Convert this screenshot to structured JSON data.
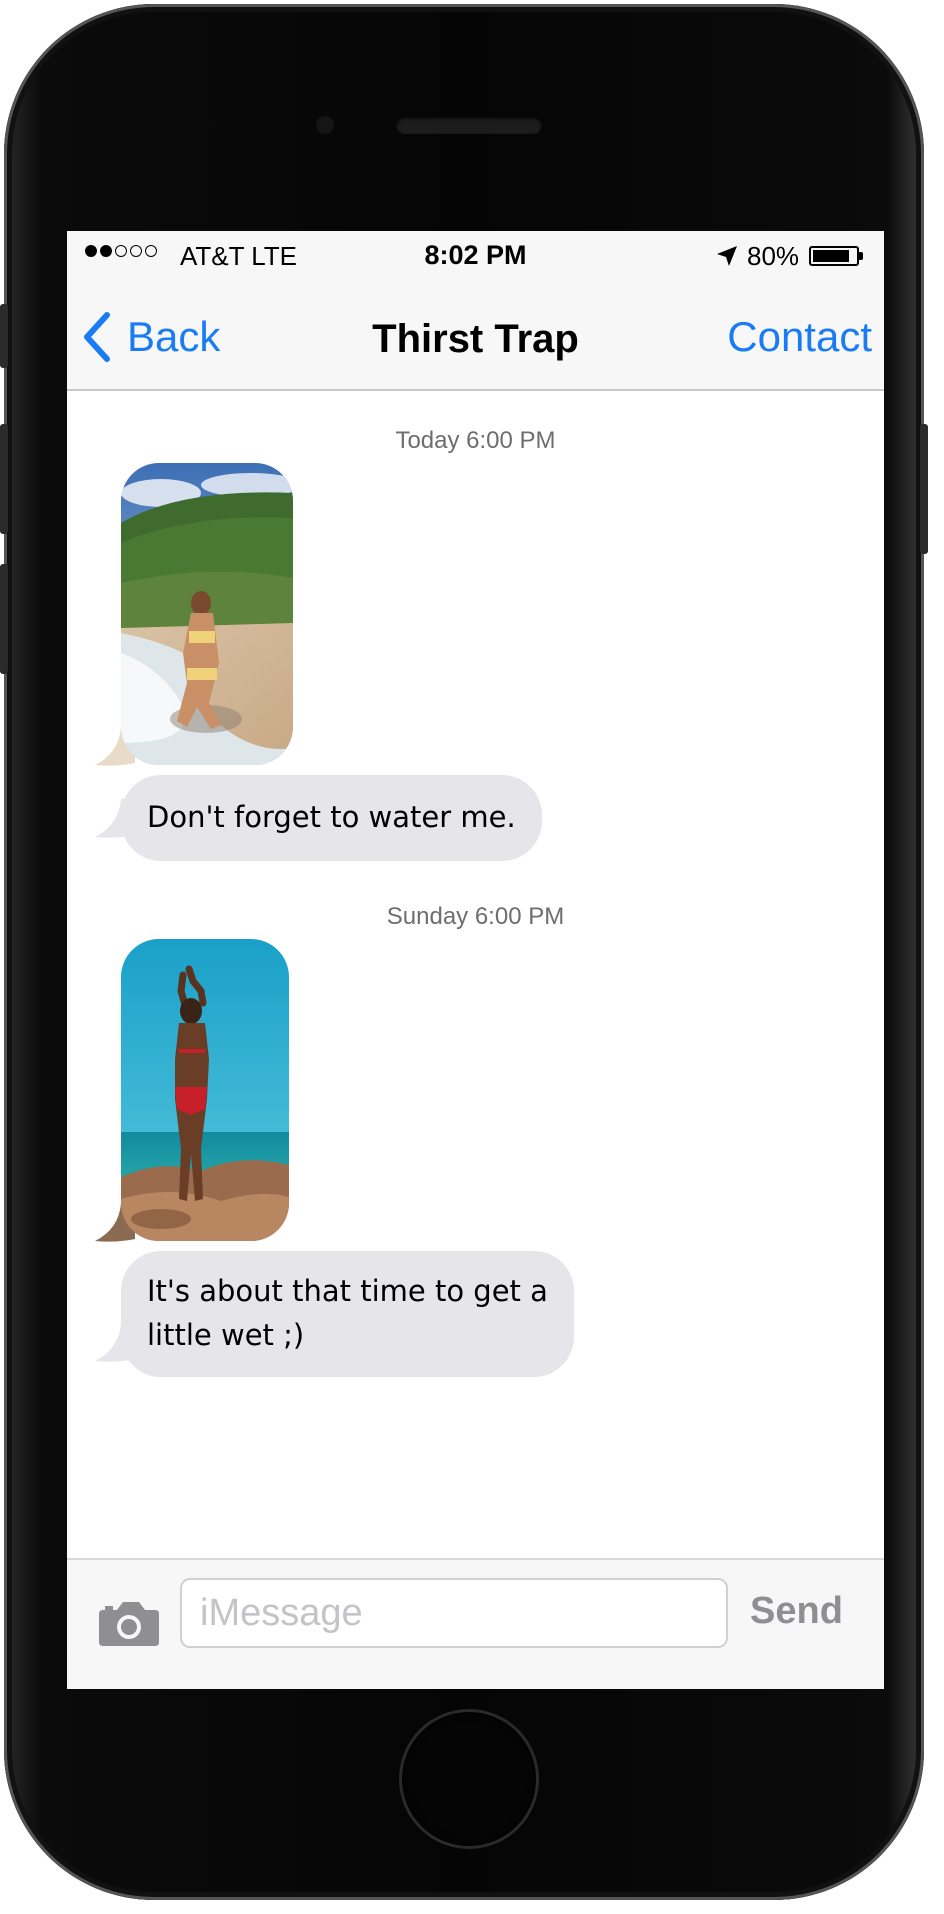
{
  "status_bar": {
    "carrier": "AT&T LTE",
    "time": "8:02 PM",
    "battery": "80%",
    "signal_bars_filled": 2,
    "signal_bars_total": 5,
    "battery_level": 0.8
  },
  "nav": {
    "back_label": "Back",
    "title": "Thirst Trap",
    "contact_label": "Contact"
  },
  "messages": {
    "timestamp_1": "Today 6:00 PM",
    "text_1": "Don't forget to water me.",
    "timestamp_2": "Sunday 6:00 PM",
    "text_2_line_1": "It's about that time to get a",
    "text_2_line_2": "little wet ;)"
  },
  "input_bar": {
    "placeholder": "iMessage",
    "value": "",
    "send_label": "Send"
  },
  "colors": {
    "ios_blue": "#1a7cf5",
    "bubble_gray": "#e5e5ea",
    "timestamp_gray": "#6d6d72",
    "bar_background": "#f7f7f8"
  },
  "icons": {
    "back": "chevron-left-icon",
    "location": "location-arrow-icon",
    "battery": "battery-icon",
    "camera": "camera-icon"
  }
}
